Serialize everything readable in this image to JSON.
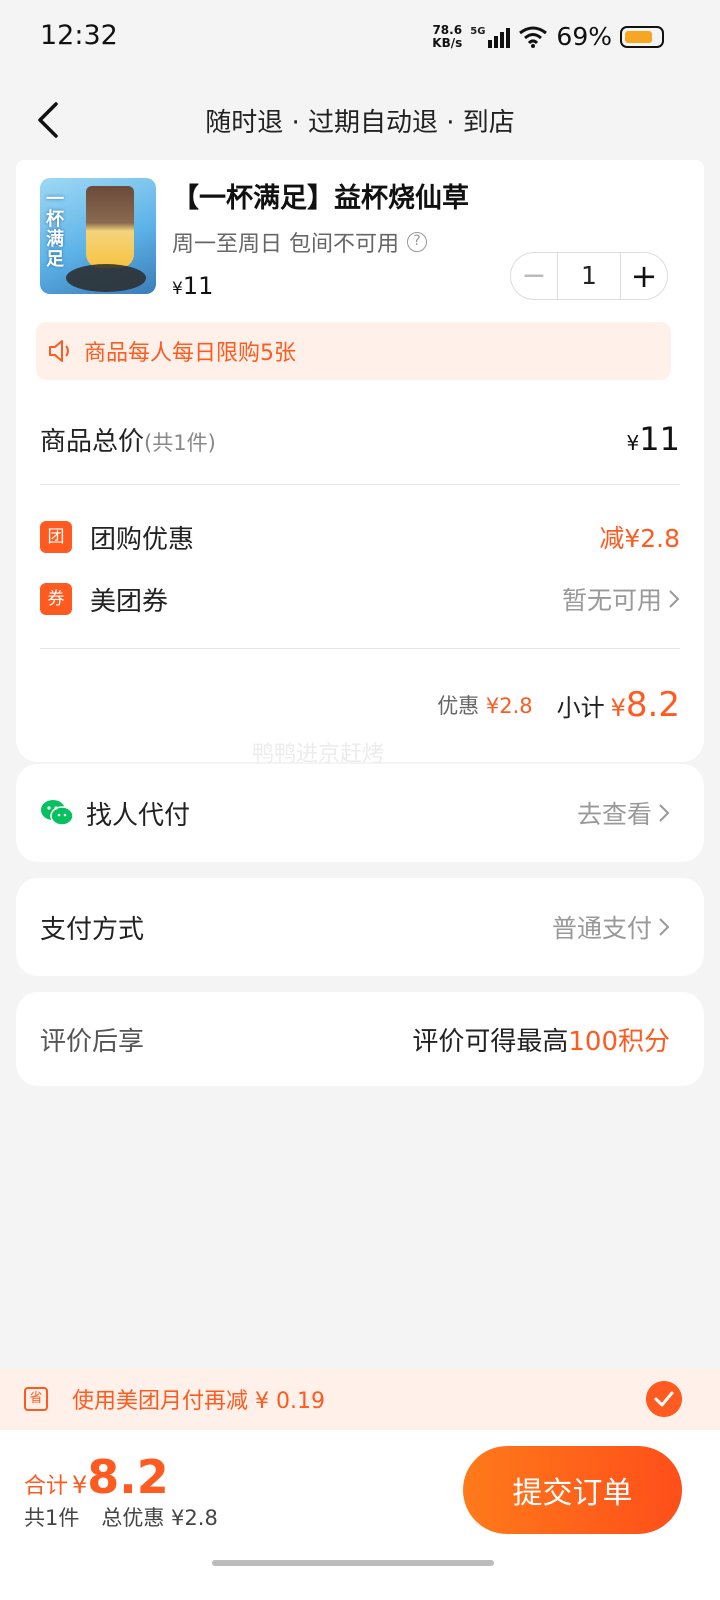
{
  "status_bar": {
    "time": "12:32",
    "net_speed_value": "78.6",
    "net_speed_unit": "KB/s",
    "network": "5G",
    "battery": "69%"
  },
  "nav": {
    "title": "随时退 · 过期自动退 · 到店"
  },
  "product": {
    "image_text": "一杯满足",
    "name": "【一杯满足】益杯烧仙草",
    "usage": "周一至周日 包间不可用",
    "help_icon": "?",
    "currency": "¥",
    "price": "11",
    "quantity": "1",
    "minus": "−",
    "plus": "+"
  },
  "limit_tip": "商品每人每日限购5张",
  "totals": {
    "label": "商品总价",
    "count_note": "(共1件)",
    "currency": "¥",
    "value": "11"
  },
  "discounts": {
    "group_badge": "团",
    "group_label": "团购优惠",
    "group_value": "减¥2.8",
    "coupon_badge": "券",
    "coupon_label": "美团券",
    "coupon_value": "暂无可用"
  },
  "subtotal": {
    "discount_label": "优惠",
    "discount_value": "¥2.8",
    "label": "小计",
    "currency": "¥",
    "value": "8.2"
  },
  "watermark": "鸭鸭进京赶烤",
  "pay_for_me": {
    "label": "找人代付",
    "action": "去查看"
  },
  "payment_method": {
    "label": "支付方式",
    "value": "普通支付"
  },
  "review": {
    "label": "评价后享",
    "prefix": "评价可得最高",
    "highlight": "100积分"
  },
  "promo": {
    "icon_text": "省",
    "text": "使用美团月付再减 ¥ 0.19"
  },
  "footer": {
    "total_label": "合计",
    "currency": "¥",
    "total_value": "8.2",
    "count": "共1件",
    "total_discount": "总优惠 ¥2.8",
    "submit": "提交订单"
  },
  "colors": {
    "accent": "#ff5a1f",
    "tip_bg": "#fff1ea",
    "page_bg": "#f4f4f4"
  }
}
